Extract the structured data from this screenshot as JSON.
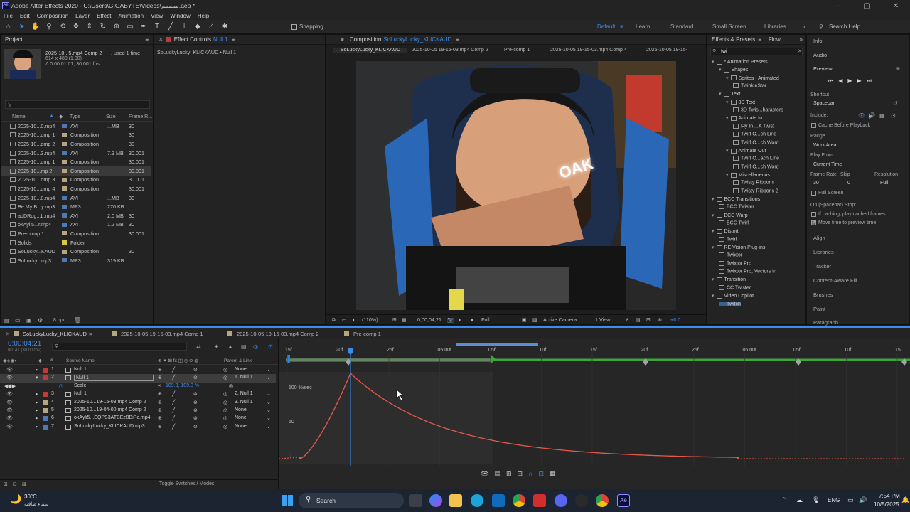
{
  "window": {
    "title": "Adobe After Effects 2020 - C:\\Users\\GIGABYTE\\Videos\\ممممم.aep *",
    "controls": [
      "—",
      "▢",
      "✕"
    ]
  },
  "menu": [
    "File",
    "Edit",
    "Composition",
    "Layer",
    "Effect",
    "Animation",
    "View",
    "Window",
    "Help"
  ],
  "toolbar": {
    "snapping_label": "Snapping",
    "workspaces": [
      "Default",
      "Learn",
      "Standard",
      "Small Screen",
      "Libraries"
    ],
    "search_help": "Search Help"
  },
  "project": {
    "tab": "Project",
    "selected_name": "2025-10...5.mp4 Comp 2",
    "used_text": ", used 1 time",
    "info_line1": "614 x 480 (1.00)",
    "info_line2": "Δ 0:00:01:01, 30.001 fps",
    "columns": [
      "Name",
      "Type",
      "Size",
      "Frame R..."
    ],
    "rows": [
      {
        "name": "2025-10...0.mp4",
        "type": "AVI",
        "size": "...MB",
        "fr": "30",
        "color": "#4d7ab5"
      },
      {
        "name": "2025-10...omp 1",
        "type": "Composition",
        "size": "",
        "fr": "30",
        "color": "#b6a67f"
      },
      {
        "name": "2025-10...omp 2",
        "type": "Composition",
        "size": "",
        "fr": "30",
        "color": "#b6a67f"
      },
      {
        "name": "2025-10...3.mp4",
        "type": "AVI",
        "size": "7.3 MB",
        "fr": "30.001",
        "color": "#4d7ab5"
      },
      {
        "name": "2025-10...omp 1",
        "type": "Composition",
        "size": "",
        "fr": "30.001",
        "color": "#b6a67f"
      },
      {
        "name": "2025-10...mp 2",
        "type": "Composition",
        "size": "",
        "fr": "30.001",
        "color": "#b6a67f"
      },
      {
        "name": "2025-10...omp 3",
        "type": "Composition",
        "size": "",
        "fr": "30.001",
        "color": "#b6a67f"
      },
      {
        "name": "2025-10...omp 4",
        "type": "Composition",
        "size": "",
        "fr": "30.001",
        "color": "#b6a67f"
      },
      {
        "name": "2025-10...8.mp4",
        "type": "AVI",
        "size": "...MB",
        "fr": "30",
        "color": "#4d7ab5"
      },
      {
        "name": "Be My B...y.mp3",
        "type": "MP3",
        "size": "270 KB",
        "fr": "",
        "color": "#4d7ab5"
      },
      {
        "name": "adDRog...L.mp4",
        "type": "AVI",
        "size": "2.0 MB",
        "fr": "30",
        "color": "#4d7ab5"
      },
      {
        "name": "okAyli5...r.mp4",
        "type": "AVI",
        "size": "1.2 MB",
        "fr": "30",
        "color": "#4d7ab5"
      },
      {
        "name": "Pre-comp 1",
        "type": "Composition",
        "size": "",
        "fr": "30.001",
        "color": "#b6a67f"
      },
      {
        "name": "Solids",
        "type": "Folder",
        "size": "",
        "fr": "",
        "color": "#d8c64a"
      },
      {
        "name": "SoLucky...KAUD",
        "type": "Composition",
        "size": "",
        "fr": "30",
        "color": "#b6a67f"
      },
      {
        "name": "SoLucky...mp3",
        "type": "MP3",
        "size": "319 KB",
        "fr": "",
        "color": "#4d7ab5"
      }
    ],
    "bpc": "8 bpc"
  },
  "effect_controls": {
    "tab": "Effect Controls",
    "target": "Null 1",
    "subtitle": "SoLuckyLucky_KLICKAUD • Null 1"
  },
  "composition": {
    "tab": "Composition",
    "name": "SoLuckyLucky_KLICKAUD",
    "breadcrumbs": [
      "SoLuckyLucky_KLICKAUD",
      "2025-10-05 19-15-03.mp4 Comp 2",
      "Pre-comp 1",
      "2025-10-05 19-15-03.mp4 Comp 4",
      "2025-10-05 19-15-"
    ],
    "zoom": "(110%)",
    "timecode": "0;00;04;21",
    "resolution": "Full",
    "camera": "Active Camera",
    "view": "1 View",
    "exposure": "+0.0",
    "overlay_text": "OAK"
  },
  "effects_presets": {
    "tab": "Effects & Presets",
    "tab2": "Flow",
    "search": "twi",
    "tree": [
      {
        "label": "* Animation Presets",
        "indent": 0,
        "type": "folder"
      },
      {
        "label": "Shapes",
        "indent": 1,
        "type": "folder"
      },
      {
        "label": "Sprites - Animated",
        "indent": 2,
        "type": "folder"
      },
      {
        "label": "TwinkleStar",
        "indent": 3,
        "type": "item"
      },
      {
        "label": "Text",
        "indent": 1,
        "type": "folder"
      },
      {
        "label": "3D Text",
        "indent": 2,
        "type": "folder"
      },
      {
        "label": "3D Twis...haracters",
        "indent": 3,
        "type": "item"
      },
      {
        "label": "Animate In",
        "indent": 2,
        "type": "folder"
      },
      {
        "label": "Fly In ...A Twist",
        "indent": 3,
        "type": "item"
      },
      {
        "label": "Twirl O...ch Line",
        "indent": 3,
        "type": "item"
      },
      {
        "label": "Twirl O...ch Word",
        "indent": 3,
        "type": "item"
      },
      {
        "label": "Animate Out",
        "indent": 2,
        "type": "folder"
      },
      {
        "label": "Twirl O...ach Line",
        "indent": 3,
        "type": "item"
      },
      {
        "label": "Twirl O...ch Word",
        "indent": 3,
        "type": "item"
      },
      {
        "label": "Miscellaneous",
        "indent": 2,
        "type": "folder"
      },
      {
        "label": "Twisty Ribbons",
        "indent": 3,
        "type": "item"
      },
      {
        "label": "Twisty Ribbons 2",
        "indent": 3,
        "type": "item"
      },
      {
        "label": "BCC Transitions",
        "indent": 0,
        "type": "folder"
      },
      {
        "label": "BCC Twister",
        "indent": 1,
        "type": "item"
      },
      {
        "label": "BCC Warp",
        "indent": 0,
        "type": "folder"
      },
      {
        "label": "BCC Twirl",
        "indent": 1,
        "type": "item"
      },
      {
        "label": "Distort",
        "indent": 0,
        "type": "folder"
      },
      {
        "label": "Twirl",
        "indent": 1,
        "type": "item"
      },
      {
        "label": "RE:Vision Plug-ins",
        "indent": 0,
        "type": "folder"
      },
      {
        "label": "Twixtor",
        "indent": 1,
        "type": "item"
      },
      {
        "label": "Twixtor Pro",
        "indent": 1,
        "type": "item"
      },
      {
        "label": "Twixtor Pro, Vectors In",
        "indent": 1,
        "type": "item"
      },
      {
        "label": "Transition",
        "indent": 0,
        "type": "folder"
      },
      {
        "label": "CC Twister",
        "indent": 1,
        "type": "item"
      },
      {
        "label": "Video Copilot",
        "indent": 0,
        "type": "folder"
      },
      {
        "label": "Twitch",
        "indent": 1,
        "type": "item"
      }
    ]
  },
  "right_panel": {
    "info": "Info",
    "audio": "Audio",
    "preview": "Preview",
    "shortcut_label": "Shortcut",
    "shortcut_value": "Spacebar",
    "include_label": "Include:",
    "cache_before": "Cache Before Playback",
    "range_label": "Range",
    "range_value": "Work Area",
    "play_from_label": "Play From",
    "play_from_value": "Current Time",
    "frame_rate_label": "Frame Rate",
    "skip_label": "Skip",
    "resolution_label": "Resolution",
    "frame_rate_value": "30",
    "skip_value": "0",
    "resolution_value": "Full",
    "full_screen": "Full Screen",
    "on_stop": "On (Spacebar) Stop:",
    "if_caching": "If caching, play cached frames",
    "move_time": "Move time to preview time",
    "sections": [
      "Align",
      "Libraries",
      "Tracker",
      "Content-Aware Fill",
      "Brushes",
      "Paint",
      "Paragraph"
    ]
  },
  "timeline": {
    "tabs": [
      "SoLuckyLucky_KLICKAUD",
      "2025-10-05 19-15-03.mp4 Comp 1",
      "2025-10-05 19-15-03.mp4 Comp 2",
      "Pre-comp 1"
    ],
    "timecode": "0:00:04:21",
    "timecode_sub": "00141 (30.00 fps)",
    "col_source": "Source Name",
    "col_parent": "Parent & Link",
    "layers": [
      {
        "num": "1",
        "name": "Null 1",
        "parent": "None",
        "color": "#c13a3a",
        "selected": false
      },
      {
        "num": "2",
        "name": "Null 1",
        "parent": "1. Null 1",
        "color": "#c13a3a",
        "selected": true
      },
      {
        "num": "",
        "name": "Scale",
        "parent": "",
        "color": "",
        "selected": false,
        "prop": true,
        "value": "109.3, 109.3 %"
      },
      {
        "num": "3",
        "name": "Null 1",
        "parent": "2. Null 1",
        "color": "#c13a3a",
        "selected": false
      },
      {
        "num": "4",
        "name": "2025-10...19-15-03.mp4 Comp 2",
        "parent": "3. Null 1",
        "color": "#b6a67f",
        "selected": false
      },
      {
        "num": "5",
        "name": "2025-10...19-04-00.mp4 Comp 2",
        "parent": "None",
        "color": "#b6a67f",
        "selected": false
      },
      {
        "num": "6",
        "name": "okAyli5...EQPB3ATBEzBBiPc.mp4",
        "parent": "None",
        "color": "#4d7ab5",
        "selected": false
      },
      {
        "num": "7",
        "name": "SoLuckyLucky_KLICKAUD.mp3",
        "parent": "None",
        "color": "#4d7ab5",
        "selected": false
      }
    ],
    "ruler": [
      "15f",
      "20f",
      "25f",
      "05:00f",
      "05f",
      "10f",
      "15f",
      "20f",
      "25f",
      "06:00f",
      "05f",
      "10f",
      "15"
    ],
    "graph_labels": [
      "100 %/sec",
      "50",
      "0"
    ],
    "toggle": "Toggle Switches / Modes"
  },
  "taskbar": {
    "weather_temp": "30°C",
    "weather_desc": "سماء صافية",
    "search": "Search",
    "lang": "ENG",
    "time": "7:54 PM",
    "date": "10/5/2025"
  },
  "colors": {
    "accent": "#3b8cf0",
    "graph": "#e8584a",
    "workarea": "#3fa43c"
  }
}
